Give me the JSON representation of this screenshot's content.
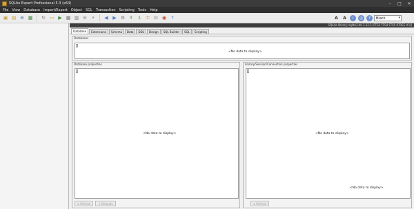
{
  "window": {
    "title": "SQLite Expert Professional 5.3 (x64)"
  },
  "menu": [
    "File",
    "View",
    "Database",
    "Import/Export",
    "Object",
    "SQL",
    "Transaction",
    "Scripting",
    "Tools",
    "Help"
  ],
  "toolbar": {
    "skin_value": "Black",
    "icons": [
      "new-database-icon",
      "open-database-icon",
      "attach-icon",
      "save-icon",
      "refresh-icon",
      "folder-icon",
      "run-icon",
      "table-icon",
      "view-icon",
      "index-icon",
      "trigger-icon",
      "back-icon",
      "forward-icon",
      "settings-icon",
      "export-icon",
      "import-icon",
      "key-icon",
      "lock-icon",
      "backup-icon",
      "help-icon"
    ]
  },
  "status": {
    "library": "SQLite library: sqlite3.dll 3.32.3 [FTS3 FTS4 FTS5 RTREE ICU]"
  },
  "tabs": [
    "Database",
    "Extensions",
    "Schema",
    "Data",
    "DDL",
    "Design",
    "SQL Builder",
    "SQL",
    "Scripting"
  ],
  "panels": {
    "databases": {
      "title": "Databases",
      "empty": "<No data to display>"
    },
    "db_properties": {
      "title": "Database properties",
      "empty": "<No data to display>"
    },
    "library_properties": {
      "title": "Library/Session/Connection properties",
      "empty": "<No data to display>"
    }
  },
  "buttons": {
    "refresh": "Refresh",
    "defaults": "Defaults",
    "refresh2": "Refresh"
  }
}
